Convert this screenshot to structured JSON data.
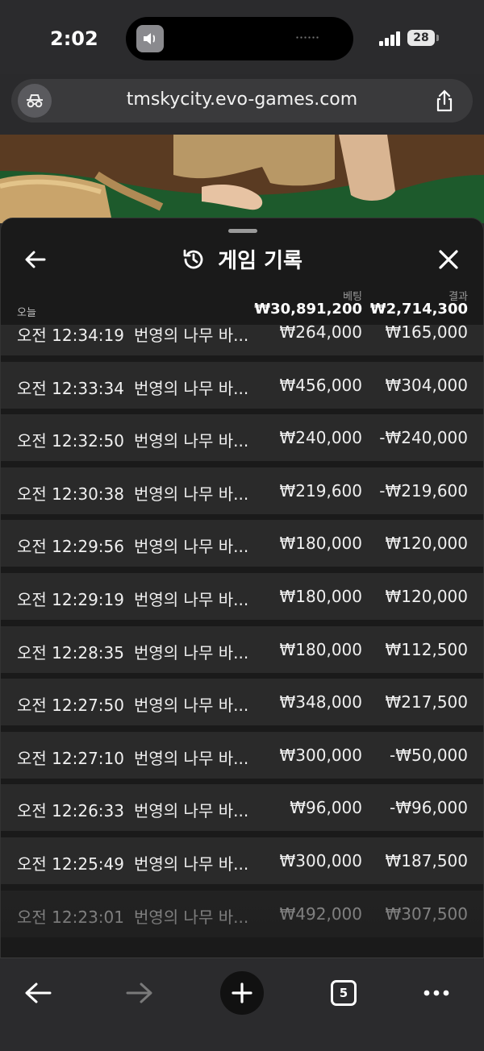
{
  "status_bar": {
    "time": "2:02",
    "battery": "28"
  },
  "browser": {
    "url": "tmskycity.evo-games.com",
    "tab_count": "5"
  },
  "panel": {
    "title": "게임 기록",
    "today_label": "오늘",
    "bet_header": "베팅",
    "result_header": "결과",
    "bet_total": "₩30,891,200",
    "result_total": "₩2,714,300"
  },
  "rows": [
    {
      "time": "오전 12:34:19",
      "game": "번영의 나무 바...",
      "bet": "₩264,000",
      "result": "₩165,000"
    },
    {
      "time": "오전 12:33:34",
      "game": "번영의 나무 바...",
      "bet": "₩456,000",
      "result": "₩304,000"
    },
    {
      "time": "오전 12:32:50",
      "game": "번영의 나무 바...",
      "bet": "₩240,000",
      "result": "-₩240,000"
    },
    {
      "time": "오전 12:30:38",
      "game": "번영의 나무 바...",
      "bet": "₩219,600",
      "result": "-₩219,600"
    },
    {
      "time": "오전 12:29:56",
      "game": "번영의 나무 바...",
      "bet": "₩180,000",
      "result": "₩120,000"
    },
    {
      "time": "오전 12:29:19",
      "game": "번영의 나무 바...",
      "bet": "₩180,000",
      "result": "₩120,000"
    },
    {
      "time": "오전 12:28:35",
      "game": "번영의 나무 바...",
      "bet": "₩180,000",
      "result": "₩112,500"
    },
    {
      "time": "오전 12:27:50",
      "game": "번영의 나무 바...",
      "bet": "₩348,000",
      "result": "₩217,500"
    },
    {
      "time": "오전 12:27:10",
      "game": "번영의 나무 바...",
      "bet": "₩300,000",
      "result": "-₩50,000"
    },
    {
      "time": "오전 12:26:33",
      "game": "번영의 나무 바...",
      "bet": "₩96,000",
      "result": "-₩96,000"
    },
    {
      "time": "오전 12:25:49",
      "game": "번영의 나무 바...",
      "bet": "₩300,000",
      "result": "₩187,500"
    },
    {
      "time": "오전 12:23:01",
      "game": "번영의 나무 바...",
      "bet": "₩492,000",
      "result": "₩307,500"
    }
  ]
}
